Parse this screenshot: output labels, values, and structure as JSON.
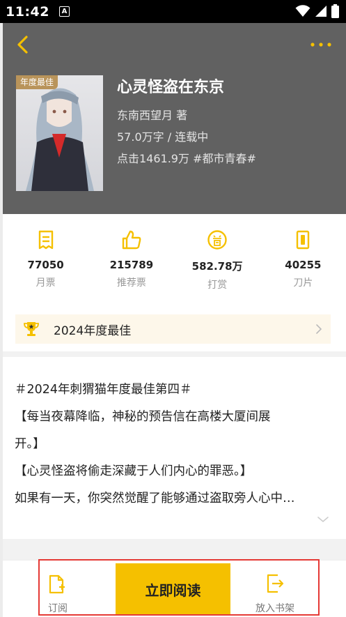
{
  "status_bar": {
    "time": "11:42",
    "notification_letter": "A"
  },
  "colors": {
    "accent": "#f5c000",
    "header_bg": "#616161",
    "highlight": "#e53935"
  },
  "header": {
    "back_icon": "chevron-left-icon",
    "more_icon": "more-dots-icon",
    "cover_badge": "年度最佳",
    "title": "心灵怪盗在东京",
    "author": "东南西望月  著",
    "word_count_status": "57.0万字 / 连载中",
    "clicks_tag": "点击1461.9万  #都市青春#"
  },
  "stats": [
    {
      "value": "77050",
      "label": "月票",
      "icon": "monthly-ticket-icon"
    },
    {
      "value": "215789",
      "label": "推荐票",
      "icon": "thumbs-up-icon"
    },
    {
      "value": "582.78万",
      "label": "打赏",
      "icon": "reward-icon"
    },
    {
      "value": "40255",
      "label": "刀片",
      "icon": "blade-icon"
    }
  ],
  "award": {
    "text": "2024年度最佳",
    "icon": "trophy-icon"
  },
  "synopsis": {
    "line1": "＃2024年刺猬猫年度最佳第四＃",
    "line2": "【每当夜幕降临，神秘的预告信在高楼大厦间展",
    "line3": "开。】",
    "line4": "【心灵怪盗将偷走深藏于人们内心的罪恶。】",
    "line5": "如果有一天，你突然觉醒了能够通过盗取旁人心中…"
  },
  "bottom_bar": {
    "subscribe_label": "订阅",
    "read_label": "立即阅读",
    "shelf_label": "放入书架"
  }
}
